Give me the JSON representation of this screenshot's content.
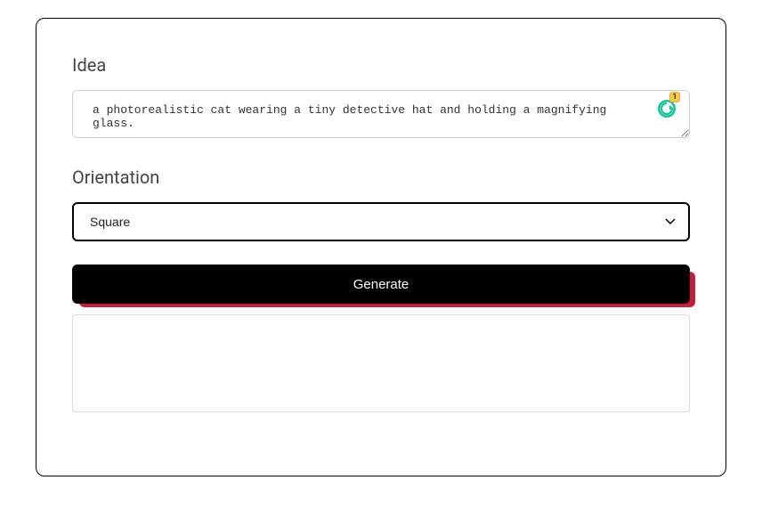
{
  "form": {
    "idea_label": "Idea",
    "idea_value": "a photorealistic cat wearing a tiny detective hat and holding a magnifying glass.",
    "orientation_label": "Orientation",
    "orientation_selected": "Square",
    "generate_label": "Generate"
  },
  "grammarly": {
    "count": "1"
  }
}
